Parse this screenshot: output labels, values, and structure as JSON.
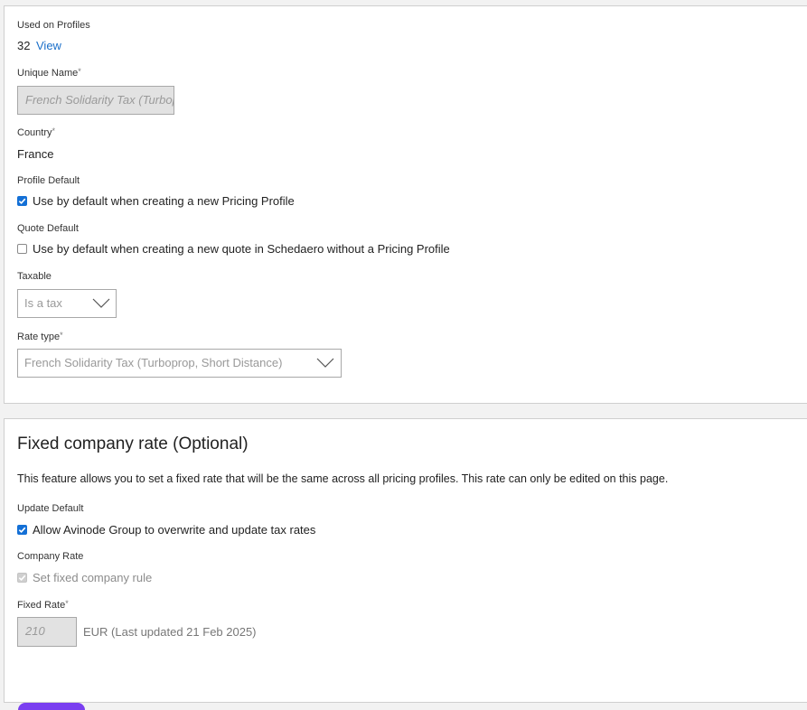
{
  "used_on_profiles": {
    "label": "Used on Profiles",
    "count": "32",
    "view_link": "View"
  },
  "unique_name": {
    "label": "Unique Name",
    "required_mark": "*",
    "value": "French Solidarity Tax (Turboprop, Short Distance)"
  },
  "country": {
    "label": "Country",
    "required_mark": "*",
    "value": "France"
  },
  "profile_default": {
    "label": "Profile Default",
    "checkbox_label": "Use by default when creating a new Pricing Profile",
    "checked": true
  },
  "quote_default": {
    "label": "Quote Default",
    "checkbox_label": "Use by default when creating a new quote in Schedaero without a Pricing Profile",
    "checked": false
  },
  "taxable": {
    "label": "Taxable",
    "selected": "Is a tax"
  },
  "rate_type": {
    "label": "Rate type",
    "required_mark": "*",
    "selected": "French Solidarity Tax (Turboprop, Short Distance)"
  },
  "fixed_company_rate": {
    "title": "Fixed company rate (Optional)",
    "description": "This feature allows you to set a fixed rate that will be the same across all pricing profiles. This rate can only be edited on this page.",
    "update_default": {
      "label": "Update Default",
      "checkbox_label": "Allow Avinode Group to overwrite and update tax rates",
      "checked": true
    },
    "company_rate": {
      "label": "Company Rate",
      "checkbox_label": "Set fixed company rule",
      "checked": true,
      "disabled": true
    },
    "fixed_rate": {
      "label": "Fixed Rate",
      "required_mark": "*",
      "value": "210",
      "unit_text": "EUR (Last updated 21 Feb 2025)"
    }
  },
  "colors": {
    "accent": "#1470d6",
    "link": "#1a6fc9",
    "purple_button": "#7a3ff0"
  }
}
